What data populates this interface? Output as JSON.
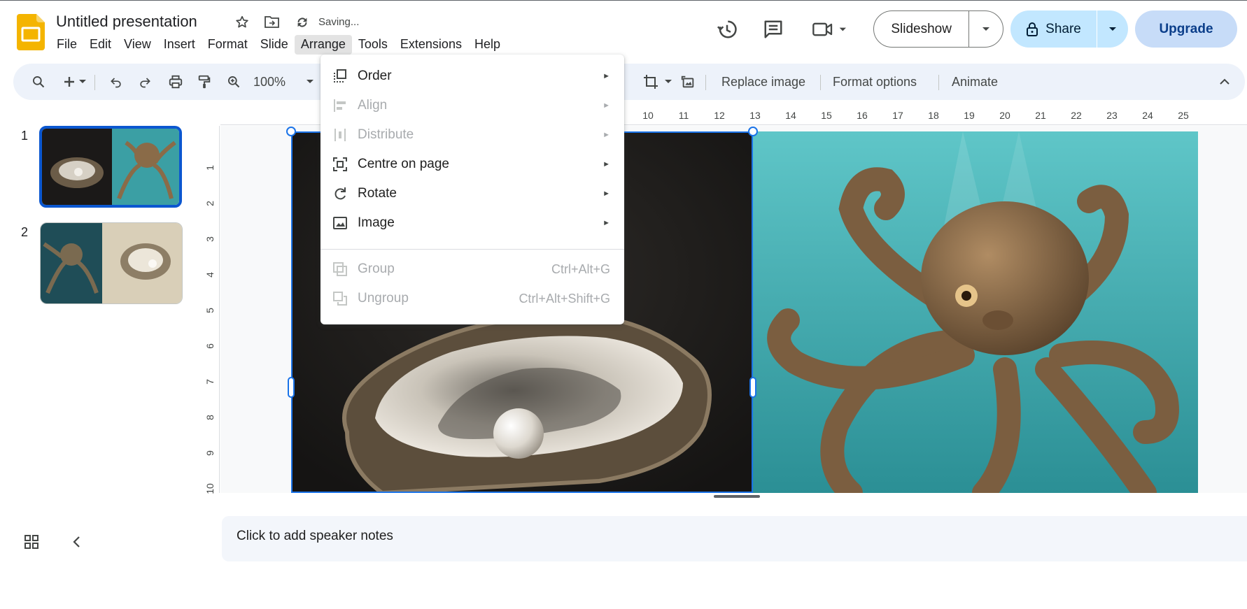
{
  "header": {
    "title": "Untitled presentation",
    "saving_status": "Saving...",
    "menu": [
      "File",
      "Edit",
      "View",
      "Insert",
      "Format",
      "Slide",
      "Arrange",
      "Tools",
      "Extensions",
      "Help"
    ],
    "active_menu": "Arrange",
    "slideshow_label": "Slideshow",
    "share_label": "Share",
    "upgrade_label": "Upgrade"
  },
  "toolbar": {
    "zoom": "100%",
    "replace_image": "Replace image",
    "format_options": "Format options",
    "animate": "Animate"
  },
  "rulers": {
    "horizontal": [
      "10",
      "11",
      "12",
      "13",
      "14",
      "15",
      "16",
      "17",
      "18",
      "19",
      "20",
      "21",
      "22",
      "23",
      "24",
      "25"
    ],
    "vertical": [
      "1",
      "2",
      "3",
      "4",
      "5",
      "6",
      "7",
      "8",
      "9",
      "10"
    ]
  },
  "slides": [
    {
      "number": "1",
      "selected": true
    },
    {
      "number": "2",
      "selected": false
    }
  ],
  "speaker_notes_placeholder": "Click to add speaker notes",
  "arrange_menu": {
    "items": [
      {
        "label": "Order",
        "icon": "order-icon",
        "disabled": false,
        "submenu": true
      },
      {
        "label": "Align",
        "icon": "align-icon",
        "disabled": true,
        "submenu": true
      },
      {
        "label": "Distribute",
        "icon": "distribute-icon",
        "disabled": true,
        "submenu": true
      },
      {
        "label": "Centre on page",
        "icon": "centre-on-page-icon",
        "disabled": false,
        "submenu": true
      },
      {
        "label": "Rotate",
        "icon": "rotate-icon",
        "disabled": false,
        "submenu": true
      },
      {
        "label": "Image",
        "icon": "image-icon",
        "disabled": false,
        "submenu": true
      }
    ],
    "group_items": [
      {
        "label": "Group",
        "shortcut": "Ctrl+Alt+G",
        "icon": "group-icon",
        "disabled": true
      },
      {
        "label": "Ungroup",
        "shortcut": "Ctrl+Alt+Shift+G",
        "icon": "ungroup-icon",
        "disabled": true
      }
    ]
  },
  "colors": {
    "accent": "#1a73e8",
    "share_bg": "#c2e7ff",
    "upgrade_bg": "#c7dcf8",
    "toolbar_bg": "#edf2fa",
    "logo_yellow": "#f4b400"
  }
}
